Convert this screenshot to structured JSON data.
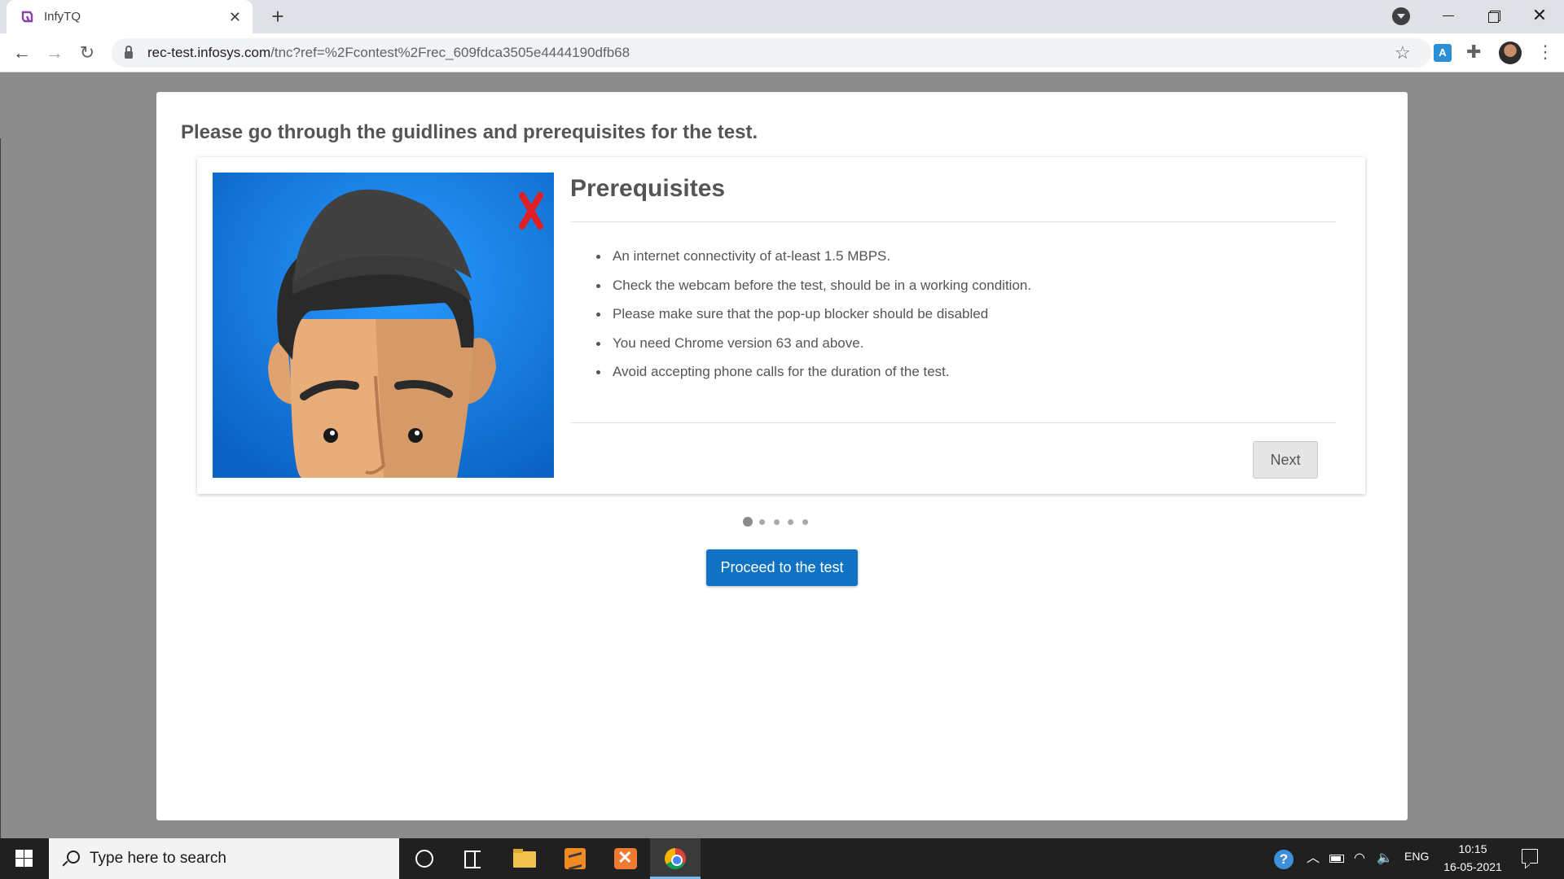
{
  "browser": {
    "tab_title": "InfyTQ",
    "url_host": "rec-test.infosys.com",
    "url_path": "/tnc?ref=%2Fcontest%2Frec_609fdca3505e4444190dfb68"
  },
  "page": {
    "heading": "Please go through the guidlines and prerequisites for the test.",
    "card": {
      "title": "Prerequisites",
      "items": [
        "An internet connectivity of at-least 1.5 MBPS.",
        "Check the webcam before the test, should be in a working condition.",
        "Please make sure that the pop-up blocker should be disabled",
        "You need Chrome version 63 and above.",
        "Avoid accepting phone calls for the duration of the test."
      ],
      "next_label": "Next"
    },
    "carousel": {
      "total_slides": 5,
      "active_slide": 1
    },
    "proceed_label": "Proceed to the test"
  },
  "taskbar": {
    "search_placeholder": "Type here to search",
    "language": "ENG",
    "time": "10:15",
    "date": "16-05-2021"
  },
  "colors": {
    "primary_button": "#0f72c3",
    "illustration_bg": "#0a7be0",
    "warning_mark": "#e01f24"
  }
}
